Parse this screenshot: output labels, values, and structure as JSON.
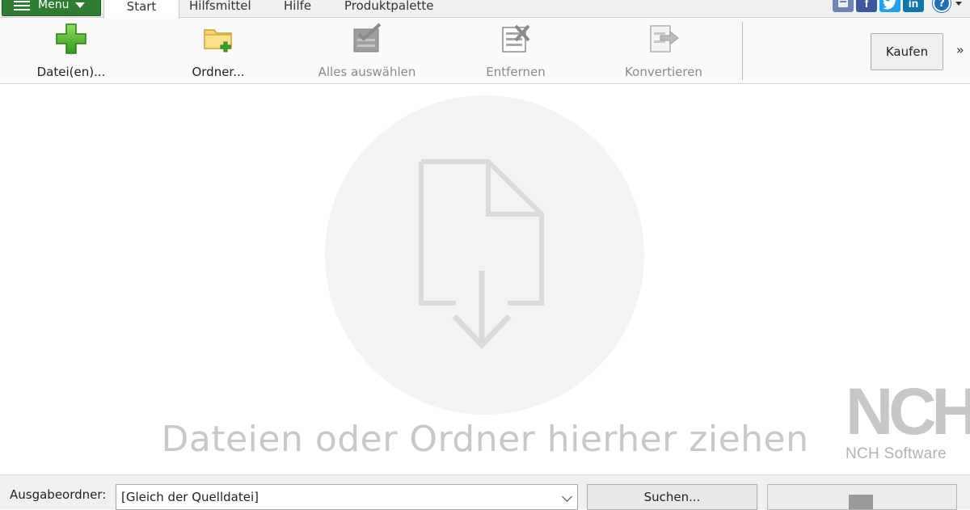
{
  "menubar": {
    "menu_label": "Menu",
    "tabs": [
      {
        "label": "Start",
        "active": true
      },
      {
        "label": "Hilfsmittel",
        "active": false
      },
      {
        "label": "Hilfe",
        "active": false
      },
      {
        "label": "Produktpalette",
        "active": false
      }
    ],
    "social": [
      {
        "name": "share-icon",
        "color": "#6d84b4"
      },
      {
        "name": "facebook-icon",
        "glyph": "f",
        "color": "#3b5998"
      },
      {
        "name": "twitter-icon",
        "glyph": "t",
        "color": "#1da1f2"
      },
      {
        "name": "linkedin-icon",
        "glyph": "in",
        "color": "#0e76a8"
      }
    ],
    "help_glyph": "?"
  },
  "toolbar": {
    "add_files": "Datei(en)...",
    "add_folder": "Ordner...",
    "select_all": "Alles auswählen",
    "remove": "Entfernen",
    "convert": "Konvertieren",
    "buy": "Kaufen",
    "more": "»"
  },
  "drop_area": {
    "hint": "Dateien oder Ordner hierher ziehen"
  },
  "brand": {
    "logo_text": "NCH",
    "company": "NCH Software"
  },
  "bottom": {
    "output_label": "Ausgabeordner:",
    "output_value": "[Gleich der Quelldatei]",
    "search_button": "Suchen..."
  },
  "colors": {
    "menu_green": "#2e7d32",
    "drop_circle": "#f3f3f3",
    "hint_text": "#c8c8c8"
  }
}
